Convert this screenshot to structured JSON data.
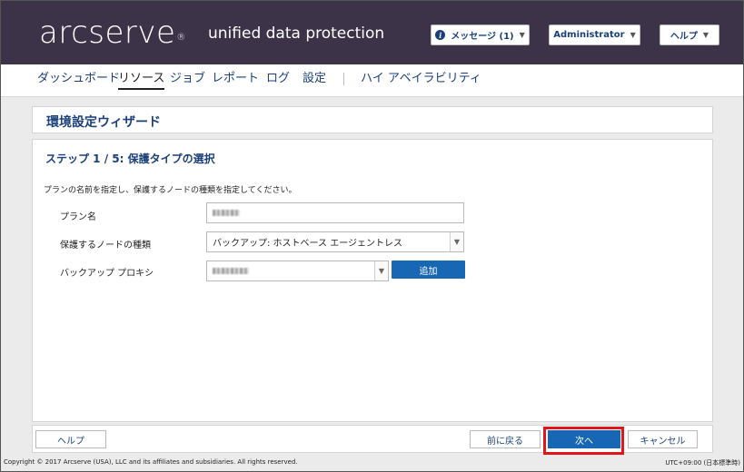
{
  "header": {
    "logo": "arcserve",
    "logo_mark": "®",
    "product": "unified data protection",
    "messages_label": "メッセージ (1)",
    "admin_label": "Administrator",
    "help_label": "ヘルプ"
  },
  "nav": {
    "items": [
      "ダッシュボード",
      "リソース",
      "ジョブ",
      "レポート",
      "ログ",
      "設定",
      "ハイ アベイラビリティ"
    ],
    "active": "リソース"
  },
  "wizard": {
    "title": "環境設定ウィザード",
    "step_title": "ステップ 1 / 5: 保護タイプの選択",
    "description": "プランの名前を指定し、保護するノードの種類を指定してください。",
    "fields": {
      "plan_name_label": "プラン名",
      "node_type_label": "保護するノードの種類",
      "node_type_value": "バックアップ: ホストベース エージェントレス",
      "proxy_label": "バックアップ プロキシ",
      "add_label": "追加"
    }
  },
  "buttons": {
    "help": "ヘルプ",
    "back": "前に戻る",
    "next": "次へ",
    "cancel": "キャンセル"
  },
  "footer": {
    "copyright": "Copyright © 2017 Arcserve (USA), LLC and its affiliates and subsidiaries. All rights reserved.",
    "timezone": "UTC+09:00 (日本標準時)"
  },
  "colors": {
    "header_bg": "#3d3348",
    "accent": "#1867b4",
    "link": "#1a3f7a",
    "highlight": "#e0161b"
  }
}
